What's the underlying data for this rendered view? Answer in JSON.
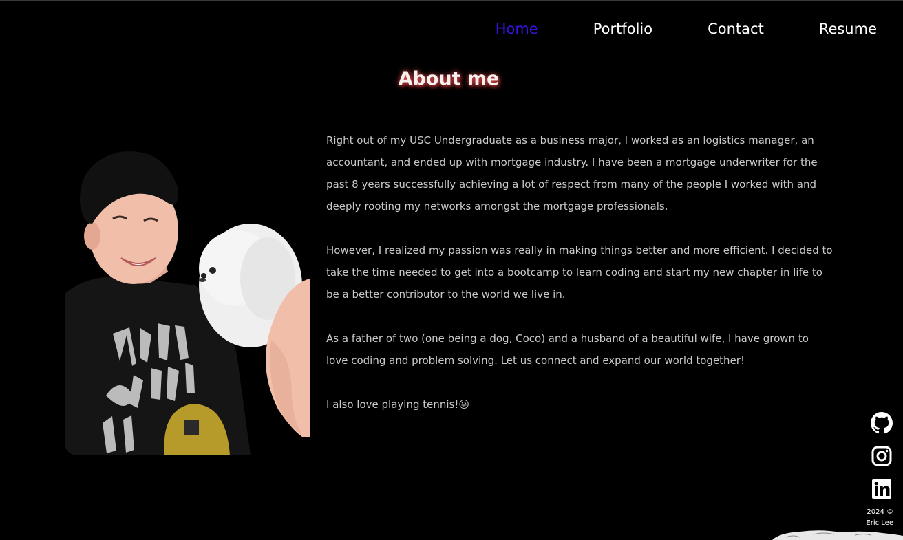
{
  "nav": {
    "items": [
      {
        "label": "Home",
        "active": true
      },
      {
        "label": "Portfolio",
        "active": false
      },
      {
        "label": "Contact",
        "active": false
      },
      {
        "label": "Resume",
        "active": false
      }
    ],
    "active_color": "#3a10e0"
  },
  "about": {
    "title": "About me",
    "paragraphs": [
      "Right out of my USC Undergraduate as a business major, I worked as an logistics manager, an accountant, and ended up with mortgage industry. I have been a mortgage underwriter for the past 8 years successfully achieving a lot of respect from many of the people I worked with and deeply rooting my networks amongst the mortgage professionals.",
      "However, I realized my passion was really in making things better and more efficient. I decided to take the time needed to get into a bootcamp to learn coding and start my new chapter in life to be a better contributor to the world we live in.",
      "As a father of two (one being a dog, Coco) and a husband of a beautiful wife, I have grown to love coding and problem solving. Let us connect and expand our world together!",
      "I also love playing tennis!"
    ],
    "emoji": "😜"
  },
  "social": [
    {
      "name": "github-icon"
    },
    {
      "name": "instagram-icon"
    },
    {
      "name": "linkedin-icon"
    }
  ],
  "footer": {
    "line1": "2024 ©",
    "line2": "Eric Lee"
  }
}
